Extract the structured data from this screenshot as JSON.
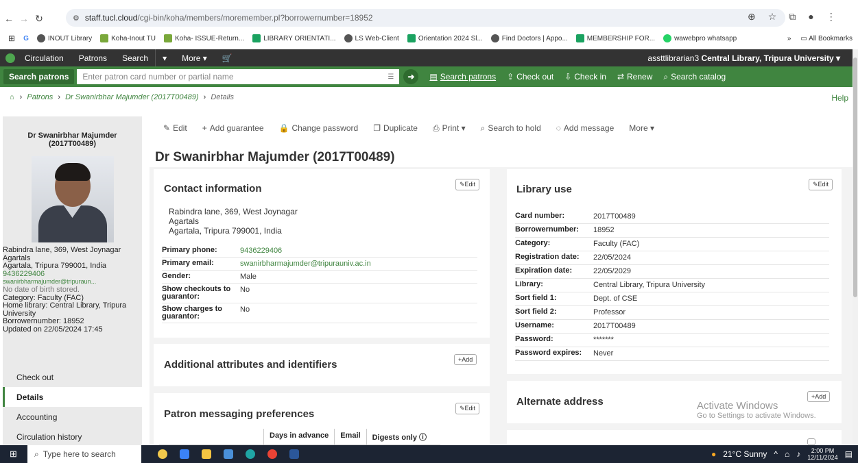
{
  "browser": {
    "url_host": "staff.tucl.cloud",
    "url_path": "/cgi-bin/koha/members/moremember.pl?borrowernumber=18952",
    "bookmarks": [
      {
        "label": "INOUT Library",
        "color": "#555"
      },
      {
        "label": "Koha-Inout TU",
        "color": "#7aa83b"
      },
      {
        "label": "Koha- ISSUE-Return...",
        "color": "#7aa83b"
      },
      {
        "label": "LIBRARY ORIENTATI...",
        "color": "#1aa260"
      },
      {
        "label": "LS Web-Client",
        "color": "#555"
      },
      {
        "label": "Orientation 2024 Sl...",
        "color": "#1aa260"
      },
      {
        "label": "Find Doctors | Appo...",
        "color": "#555"
      },
      {
        "label": "MEMBERSHIP FOR...",
        "color": "#1aa260"
      },
      {
        "label": "wawebpro whatsapp",
        "color": "#25d366"
      }
    ],
    "all_bookmarks": "All Bookmarks"
  },
  "topnav": {
    "items": [
      "Circulation",
      "Patrons",
      "Search"
    ],
    "more": "More ▾",
    "user": "assttlibrarian3",
    "library": "Central Library, Tripura University ▾"
  },
  "searchbar": {
    "label": "Search patrons",
    "placeholder": "Enter patron card number or partial name",
    "links": [
      "Search patrons",
      "Check out",
      "Check in",
      "Renew",
      "Search catalog"
    ]
  },
  "breadcrumb": {
    "patrons": "Patrons",
    "patron": "Dr Swanirbhar Majumder (2017T00489)",
    "current": "Details",
    "help": "Help"
  },
  "sidebar": {
    "name_line1": "Dr Swanirbhar Majumder",
    "name_line2": "(2017T00489)",
    "address1": "Rabindra lane, 369, West Joynagar",
    "address2": "Agartals",
    "address3": "Agartala, Tripura 799001, India",
    "phone": "9436229406",
    "email": "swanirbharmajumder@tripuraun...",
    "dob": "No date of birth stored.",
    "category": "Category: Faculty (FAC)",
    "home_library": "Home library: Central Library, Tripura University",
    "borrowernumber": "Borrowernumber: 18952",
    "updated": "Updated on 22/05/2024 17:45",
    "menu": [
      "Check out",
      "Details",
      "Accounting",
      "Circulation history"
    ]
  },
  "toolbar": [
    "Edit",
    "Add guarantee",
    "Change password",
    "Duplicate",
    "Print ▾",
    "Search to hold",
    "Add message",
    "More ▾"
  ],
  "page_title": "Dr Swanirbhar Majumder (2017T00489)",
  "contact": {
    "title": "Contact information",
    "edit": "Edit",
    "address1": "Rabindra lane, 369, West Joynagar",
    "address2": "Agartals",
    "address3": "Agartala, Tripura 799001, India",
    "rows": [
      {
        "k": "Primary phone:",
        "v": "9436229406",
        "green": true
      },
      {
        "k": "Primary email:",
        "v": "swanirbharmajumder@tripurauniv.ac.in",
        "green": true
      },
      {
        "k": "Gender:",
        "v": "Male",
        "green": false
      },
      {
        "k": "Show checkouts to guarantor:",
        "v": "No",
        "green": false
      },
      {
        "k": "Show charges to guarantor:",
        "v": "No",
        "green": false
      }
    ]
  },
  "additional": {
    "title": "Additional attributes and identifiers",
    "add": "Add"
  },
  "messaging": {
    "title": "Patron messaging preferences",
    "edit": "Edit",
    "columns": [
      "Days in advance",
      "Email",
      "Digests only"
    ]
  },
  "library_use": {
    "title": "Library use",
    "edit": "Edit",
    "rows": [
      {
        "k": "Card number:",
        "v": "2017T00489"
      },
      {
        "k": "Borrowernumber:",
        "v": "18952"
      },
      {
        "k": "Category:",
        "v": "Faculty (FAC)"
      },
      {
        "k": "Registration date:",
        "v": "22/05/2024"
      },
      {
        "k": "Expiration date:",
        "v": "22/05/2029"
      },
      {
        "k": "Library:",
        "v": "Central Library, Tripura University"
      },
      {
        "k": "Sort field 1:",
        "v": "Dept. of CSE"
      },
      {
        "k": "Sort field 2:",
        "v": "Professor"
      },
      {
        "k": "Username:",
        "v": "2017T00489"
      },
      {
        "k": "Password:",
        "v": "*******"
      },
      {
        "k": "Password expires:",
        "v": "Never"
      }
    ]
  },
  "alternate": {
    "title": "Alternate address",
    "add": "Add"
  },
  "watermark": {
    "line1": "Activate Windows",
    "line2": "Go to Settings to activate Windows."
  },
  "taskbar": {
    "search": "Type here to search",
    "weather": "21°C  Sunny",
    "time": "2:00 PM",
    "date": "12/11/2024"
  }
}
